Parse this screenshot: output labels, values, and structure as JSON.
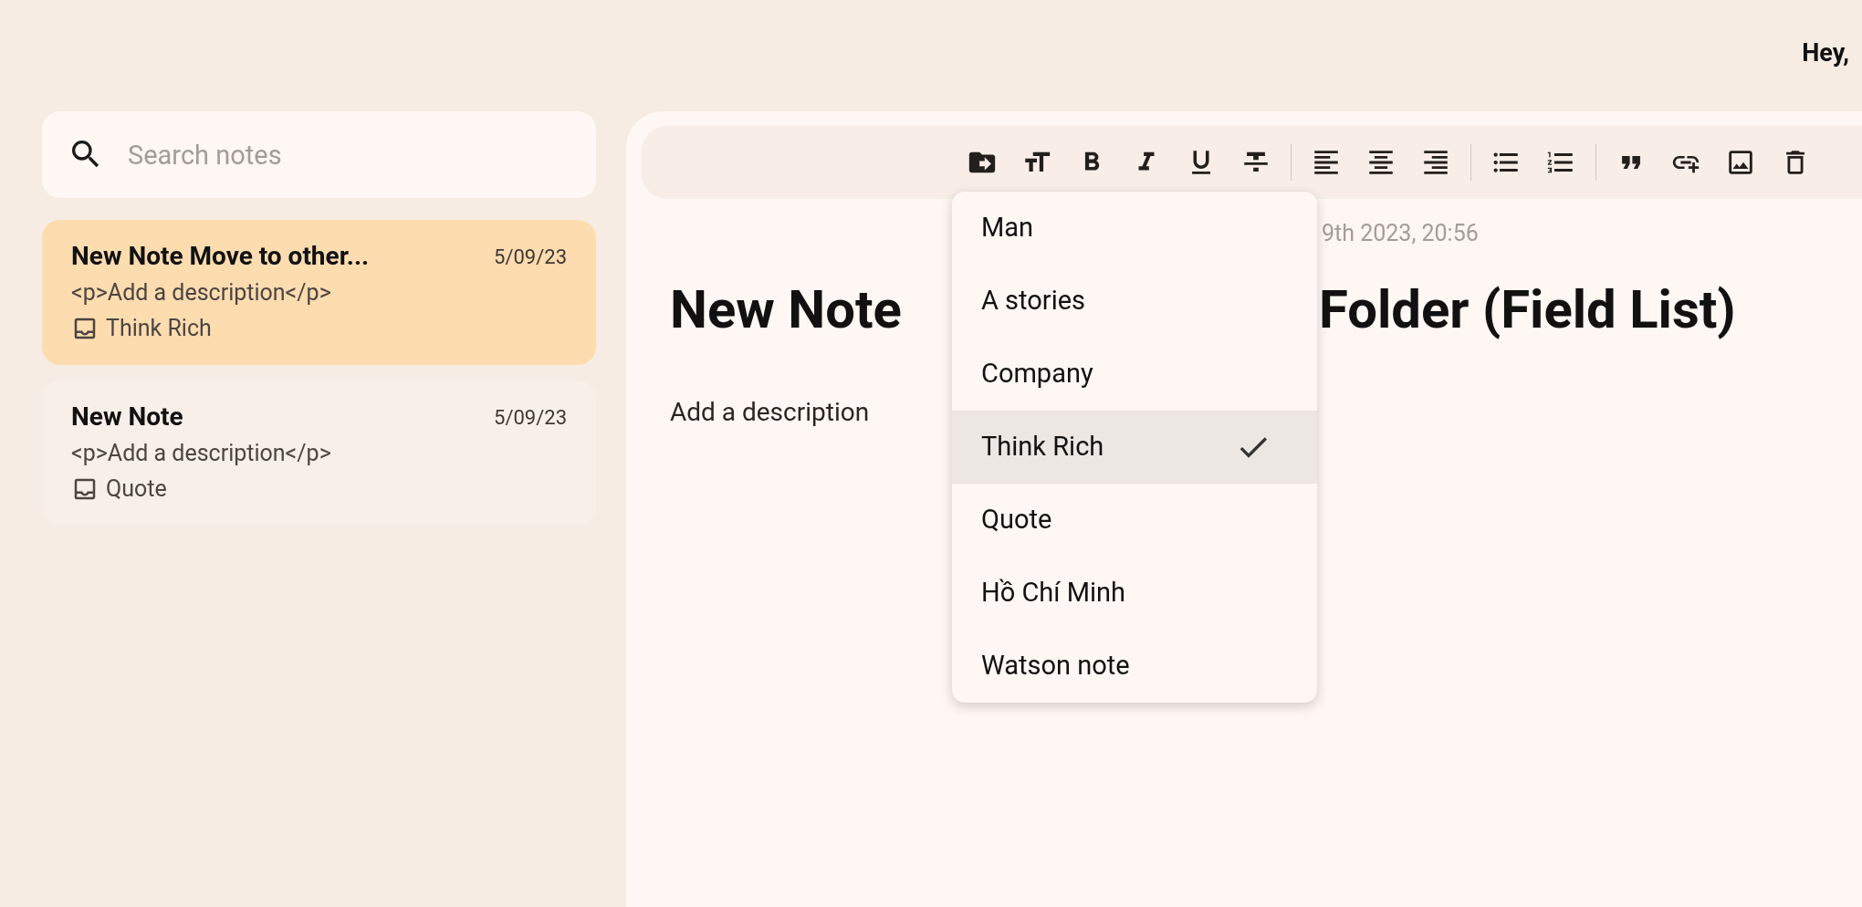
{
  "header": {
    "greeting": "Hey,"
  },
  "search": {
    "placeholder": "Search notes"
  },
  "notes": [
    {
      "title": "New Note Move to other...",
      "date": "5/09/23",
      "description": "<p>Add a description</p>",
      "folder": "Think Rich",
      "selected": true
    },
    {
      "title": "New Note",
      "date": "5/09/23",
      "description": "<p>Add a description</p>",
      "folder": "Quote",
      "selected": false
    }
  ],
  "editor": {
    "date": "9th 2023, 20:56",
    "title_start": "New Note",
    "title_end": "Folder (Field List)",
    "body": "Add a description"
  },
  "folder_menu": [
    {
      "label": "Man",
      "selected": false
    },
    {
      "label": "A stories",
      "selected": false
    },
    {
      "label": "Company",
      "selected": false
    },
    {
      "label": "Think Rich",
      "selected": true
    },
    {
      "label": "Quote",
      "selected": false
    },
    {
      "label": "Hồ Chí Minh",
      "selected": false
    },
    {
      "label": "Watson note",
      "selected": false
    }
  ]
}
